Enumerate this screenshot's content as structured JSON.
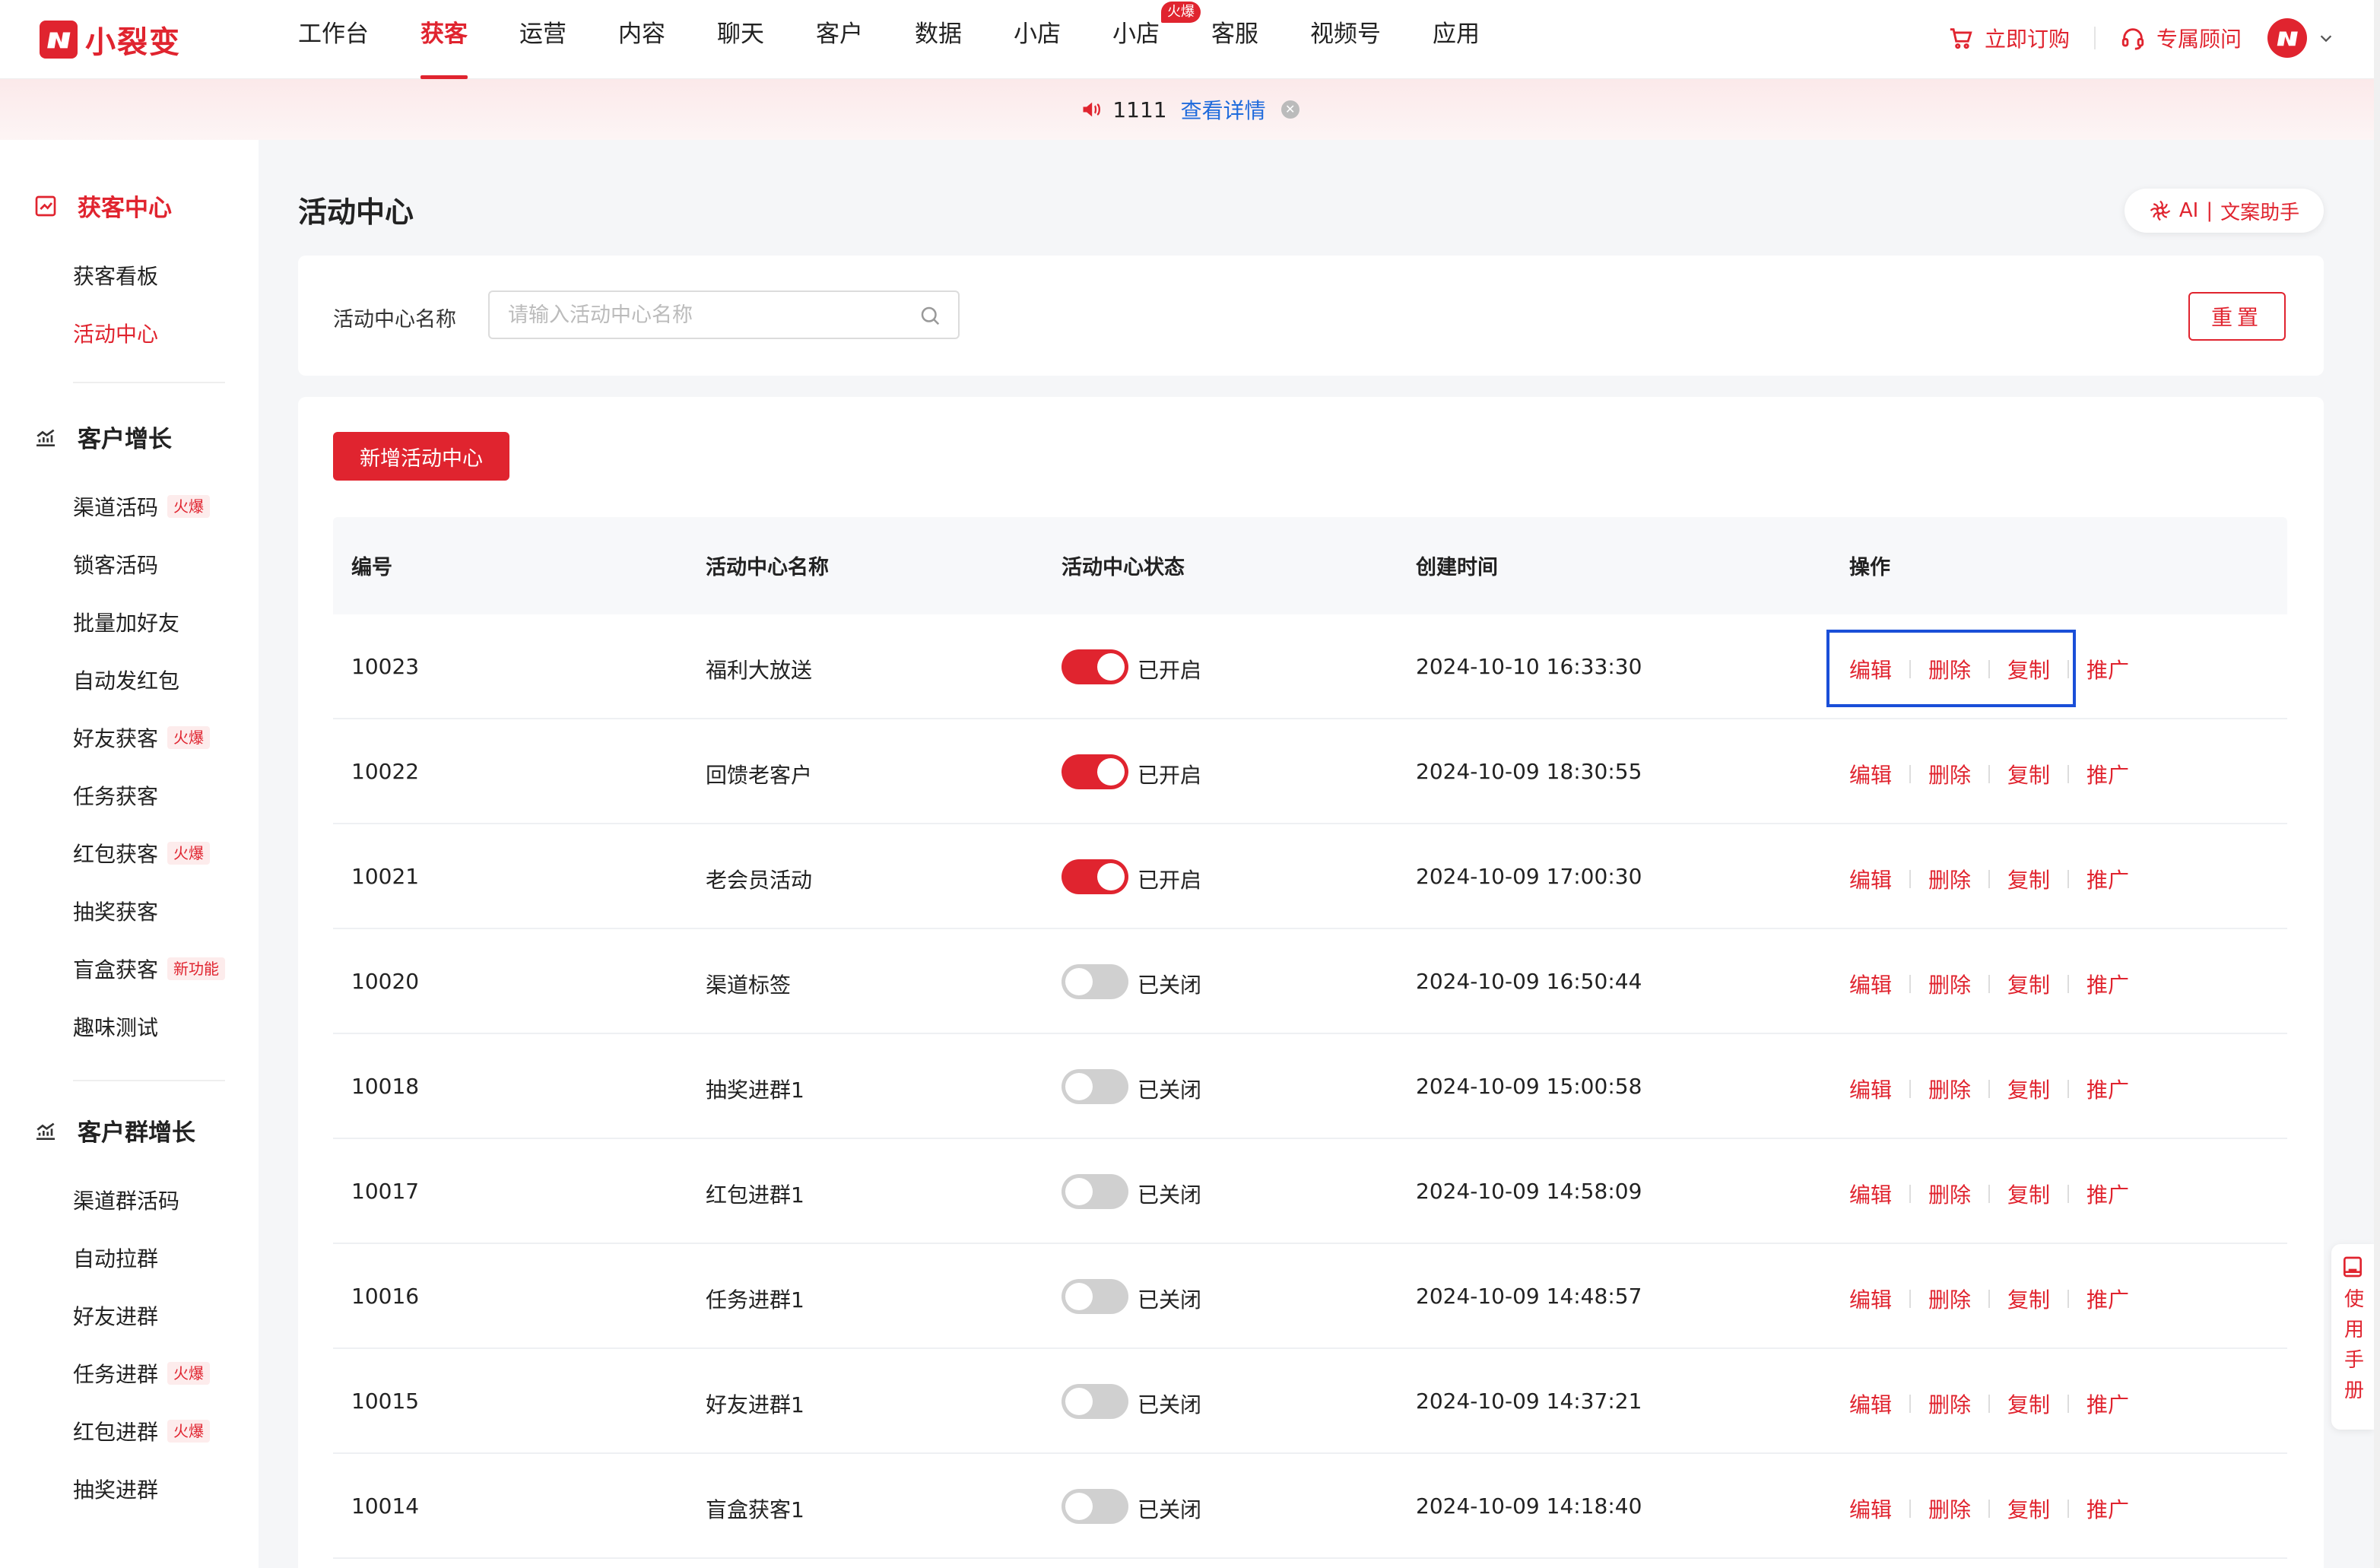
{
  "brand": {
    "name": "小裂变",
    "color": "#e0242f"
  },
  "topnav": {
    "items": [
      {
        "label": "工作台"
      },
      {
        "label": "获客",
        "active": true
      },
      {
        "label": "运营"
      },
      {
        "label": "内容"
      },
      {
        "label": "聊天"
      },
      {
        "label": "客户"
      },
      {
        "label": "数据"
      },
      {
        "label": "小店"
      },
      {
        "label": "小店",
        "badge": "火爆"
      },
      {
        "label": "客服"
      },
      {
        "label": "视频号"
      },
      {
        "label": "应用"
      }
    ],
    "order_label": "立即订购",
    "consultant_label": "专属顾问"
  },
  "notice": {
    "text": "1111",
    "link": "查看详情"
  },
  "sidebar": {
    "sections": [
      {
        "title": "获客中心",
        "active": true,
        "items": [
          {
            "label": "获客看板"
          },
          {
            "label": "活动中心",
            "active": true
          }
        ]
      },
      {
        "title": "客户增长",
        "items": [
          {
            "label": "渠道活码",
            "tag": "火爆"
          },
          {
            "label": "锁客活码"
          },
          {
            "label": "批量加好友"
          },
          {
            "label": "自动发红包"
          },
          {
            "label": "好友获客",
            "tag": "火爆"
          },
          {
            "label": "任务获客"
          },
          {
            "label": "红包获客",
            "tag": "火爆"
          },
          {
            "label": "抽奖获客"
          },
          {
            "label": "盲盒获客",
            "tag": "新功能"
          },
          {
            "label": "趣味测试"
          }
        ]
      },
      {
        "title": "客户群增长",
        "items": [
          {
            "label": "渠道群活码"
          },
          {
            "label": "自动拉群"
          },
          {
            "label": "好友进群"
          },
          {
            "label": "任务进群",
            "tag": "火爆"
          },
          {
            "label": "红包进群",
            "tag": "火爆"
          },
          {
            "label": "抽奖进群"
          }
        ]
      }
    ]
  },
  "page": {
    "title": "活动中心",
    "ai_label": "AI",
    "ai_tool": "文案助手"
  },
  "filter": {
    "label": "活动中心名称",
    "placeholder": "请输入活动中心名称",
    "value": "",
    "reset_label": "重置"
  },
  "table": {
    "add_label": "新增活动中心",
    "headers": [
      "编号",
      "活动中心名称",
      "活动中心状态",
      "创建时间",
      "操作"
    ],
    "actions": [
      "编辑",
      "删除",
      "复制",
      "推广"
    ],
    "rows": [
      {
        "id": "10023",
        "name": "福利大放送",
        "on": true,
        "status": "已开启",
        "created": "2024-10-10 16:33:30"
      },
      {
        "id": "10022",
        "name": "回馈老客户",
        "on": true,
        "status": "已开启",
        "created": "2024-10-09 18:30:55"
      },
      {
        "id": "10021",
        "name": "老会员活动",
        "on": true,
        "status": "已开启",
        "created": "2024-10-09 17:00:30"
      },
      {
        "id": "10020",
        "name": "渠道标签",
        "on": false,
        "status": "已关闭",
        "created": "2024-10-09 16:50:44"
      },
      {
        "id": "10018",
        "name": "抽奖进群1",
        "on": false,
        "status": "已关闭",
        "created": "2024-10-09 15:00:58"
      },
      {
        "id": "10017",
        "name": "红包进群1",
        "on": false,
        "status": "已关闭",
        "created": "2024-10-09 14:58:09"
      },
      {
        "id": "10016",
        "name": "任务进群1",
        "on": false,
        "status": "已关闭",
        "created": "2024-10-09 14:48:57"
      },
      {
        "id": "10015",
        "name": "好友进群1",
        "on": false,
        "status": "已关闭",
        "created": "2024-10-09 14:37:21"
      },
      {
        "id": "10014",
        "name": "盲盒获客1",
        "on": false,
        "status": "已关闭",
        "created": "2024-10-09 14:18:40"
      }
    ]
  },
  "manual": {
    "label": "使用手册"
  }
}
